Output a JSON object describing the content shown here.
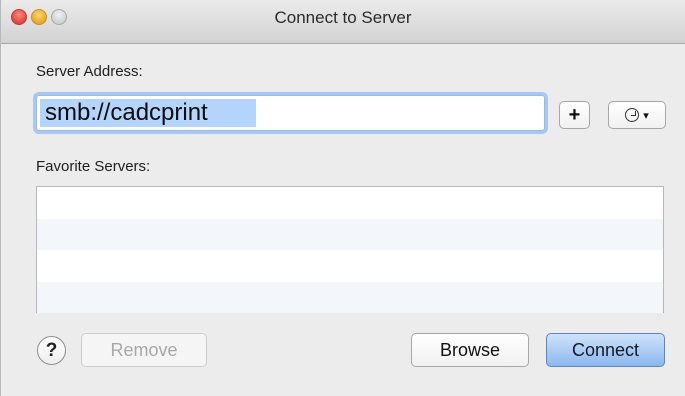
{
  "window": {
    "title": "Connect to Server",
    "controls": [
      "close",
      "minimize",
      "zoom"
    ]
  },
  "server_address": {
    "label": "Server Address:",
    "value": "smb://cadcprint",
    "add_button_label": "+",
    "recent_servers_icon": "clock-icon",
    "recent_servers_caret": "▾"
  },
  "favorites": {
    "label": "Favorite Servers:",
    "items": []
  },
  "footer": {
    "help_label": "?",
    "remove_label": "Remove",
    "browse_label": "Browse",
    "connect_label": "Connect"
  },
  "colors": {
    "selection": "#b4d4fc",
    "focus_ring": "#a8c8f4",
    "default_button": "#8cb8ee",
    "close": "#e0443e",
    "minimize": "#e8a62c"
  }
}
